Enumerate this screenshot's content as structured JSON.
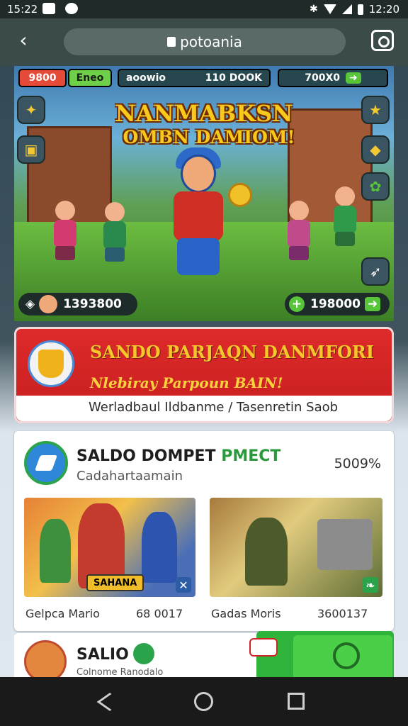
{
  "status": {
    "time": "15:22",
    "right_time": "12:20"
  },
  "browser": {
    "url": "potoania"
  },
  "banner": {
    "chip_left": "9800",
    "chip_left2": "Eneo",
    "chip_user": "aoowio",
    "chip_mid": "110 DOOK",
    "chip_right": "700X0",
    "title_line1": "NANMABKSN",
    "title_line2": "OMBN DAMIOM!",
    "bottom_left": "1393800",
    "bottom_right": "198000"
  },
  "promo": {
    "line1": "SANDO PARJAQN DANMFORI",
    "line2": "Nlebiray Parpoun BAIN!",
    "line3": "Werladbaul Ildbanme / Tasenretin Saob"
  },
  "card": {
    "name_a": "SALDO DOMPET",
    "name_b": "PMECT",
    "subtitle": "Cadahartaamain",
    "percent": "5009%",
    "thumb1_tag": "SAHANA",
    "thumb1_label": "Gelpca Mario",
    "thumb1_value": "68 0017",
    "thumb2_label": "Gadas Moris",
    "thumb2_value": "3600137"
  },
  "card2": {
    "name": "SALIO",
    "subtitle": "Colnome Ranodalo"
  },
  "colors": {
    "accent_red": "#d42121",
    "accent_green": "#2fb33a",
    "gold": "#f8c91d"
  }
}
